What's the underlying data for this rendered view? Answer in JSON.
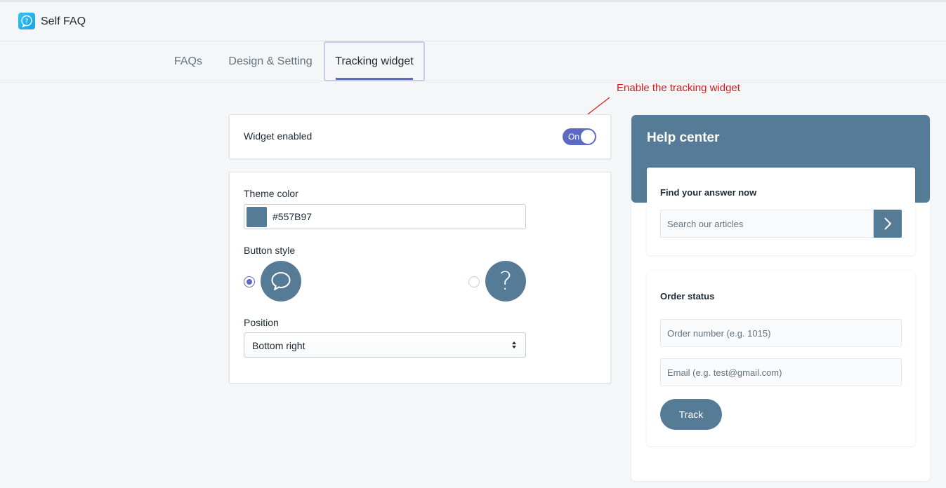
{
  "app": {
    "title": "Self FAQ"
  },
  "tabs": [
    {
      "label": "FAQs"
    },
    {
      "label": "Design & Setting"
    },
    {
      "label": "Tracking widget",
      "active": true
    }
  ],
  "annotation": {
    "text": "Enable the tracking widget"
  },
  "enable_card": {
    "label": "Widget enabled",
    "toggle_text": "On",
    "enabled": true
  },
  "settings": {
    "theme_color_label": "Theme color",
    "theme_color_value": "#557B97",
    "button_style_label": "Button style",
    "button_styles": [
      {
        "icon": "chat-bubble-icon",
        "selected": true
      },
      {
        "icon": "question-mark-icon",
        "selected": false
      }
    ],
    "position_label": "Position",
    "position_value": "Bottom right"
  },
  "preview": {
    "title": "Help center",
    "find_title": "Find your answer now",
    "search_placeholder": "Search our articles",
    "order_title": "Order status",
    "order_placeholder": "Order number (e.g. 1015)",
    "email_placeholder": "Email (e.g. test@gmail.com)",
    "track_label": "Track"
  },
  "colors": {
    "accent": "#5c6ac4",
    "theme": "#557B97",
    "annotation": "#d41c1c"
  }
}
